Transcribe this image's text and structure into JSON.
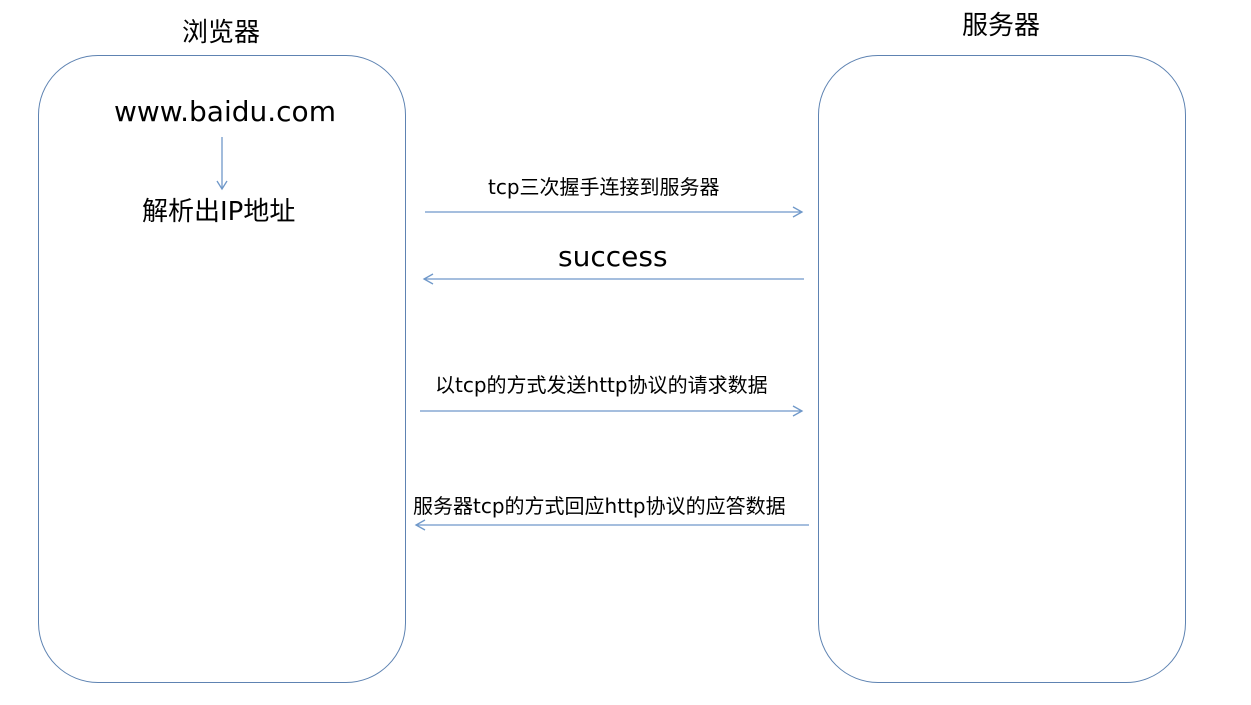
{
  "titles": {
    "browser": "浏览器",
    "server": "服务器"
  },
  "browser_box": {
    "url": "www.baidu.com",
    "resolve": "解析出IP地址"
  },
  "messages": [
    {
      "label": "tcp三次握手连接到服务器",
      "direction": "to-server"
    },
    {
      "label": "success",
      "direction": "to-browser"
    },
    {
      "label": "以tcp的方式发送http协议的请求数据",
      "direction": "to-server"
    },
    {
      "label": "服务器tcp的方式回应http协议的应答数据",
      "direction": "to-browser"
    }
  ],
  "colors": {
    "box_border": "#5e83b2",
    "arrow": "#6f98c9",
    "text": "#000000"
  }
}
